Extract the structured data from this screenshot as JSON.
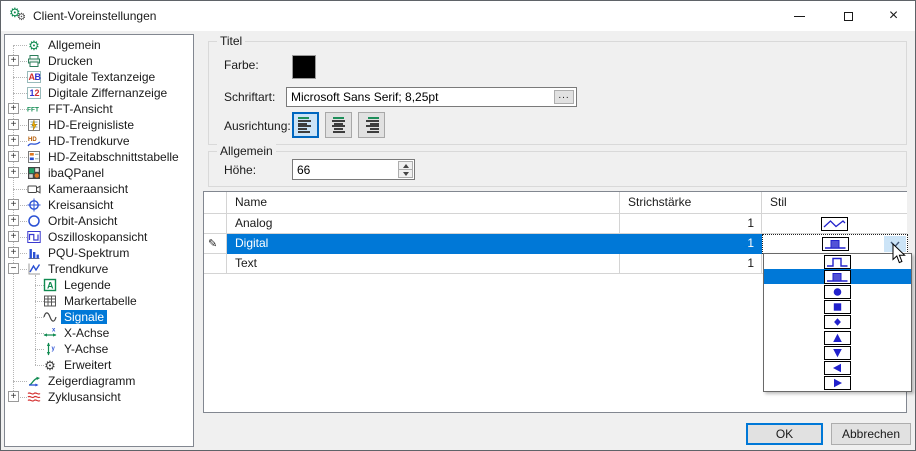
{
  "window": {
    "title": "Client-Voreinstellungen",
    "close_glyph": "×"
  },
  "tree": [
    {
      "label": "Allgemein",
      "icon": "gear-green-icon",
      "level": 0,
      "expander": null
    },
    {
      "label": "Drucken",
      "icon": "printer-icon",
      "level": 0,
      "expander": "plus"
    },
    {
      "label": "Digitale Textanzeige",
      "icon": "text-display-icon",
      "level": 0,
      "expander": null
    },
    {
      "label": "Digitale Ziffernanzeige",
      "icon": "digit-display-icon",
      "level": 0,
      "expander": null
    },
    {
      "label": "FFT-Ansicht",
      "icon": "fft-icon",
      "level": 0,
      "expander": "plus"
    },
    {
      "label": "HD-Ereignisliste",
      "icon": "hd-eventlist-icon",
      "level": 0,
      "expander": "plus"
    },
    {
      "label": "HD-Trendkurve",
      "icon": "hd-trend-icon",
      "level": 0,
      "expander": "plus"
    },
    {
      "label": "HD-Zeitabschnittstabelle",
      "icon": "hd-table-icon",
      "level": 0,
      "expander": "plus"
    },
    {
      "label": "ibaQPanel",
      "icon": "qpanel-icon",
      "level": 0,
      "expander": "plus"
    },
    {
      "label": "Kameraansicht",
      "icon": "camera-icon",
      "level": 0,
      "expander": null
    },
    {
      "label": "Kreisansicht",
      "icon": "kreis-icon",
      "level": 0,
      "expander": "plus"
    },
    {
      "label": "Orbit-Ansicht",
      "icon": "orbit-icon",
      "level": 0,
      "expander": "plus"
    },
    {
      "label": "Oszilloskopansicht",
      "icon": "oszilloskop-icon",
      "level": 0,
      "expander": "plus"
    },
    {
      "label": "PQU-Spektrum",
      "icon": "spektrum-icon",
      "level": 0,
      "expander": "plus"
    },
    {
      "label": "Trendkurve",
      "icon": "trendkurve-icon",
      "level": 0,
      "expander": "minus"
    },
    {
      "label": "Legende",
      "icon": "legende-icon",
      "level": 1,
      "expander": null
    },
    {
      "label": "Markertabelle",
      "icon": "markertabelle-icon",
      "level": 1,
      "expander": null
    },
    {
      "label": "Signale",
      "icon": "signale-icon",
      "level": 1,
      "expander": null,
      "selected": true
    },
    {
      "label": "X-Achse",
      "icon": "x-achse-icon",
      "level": 1,
      "expander": null
    },
    {
      "label": "Y-Achse",
      "icon": "y-achse-icon",
      "level": 1,
      "expander": null
    },
    {
      "label": "Erweitert",
      "icon": "gear-dark-icon",
      "level": 1,
      "expander": null
    },
    {
      "label": "Zeigerdiagramm",
      "icon": "zeiger-icon",
      "level": 0,
      "expander": null
    },
    {
      "label": "Zyklusansicht",
      "icon": "zyklus-icon",
      "level": 0,
      "expander": "plus"
    }
  ],
  "titel_group": {
    "label": "Titel",
    "farbe_label": "Farbe:",
    "farbe_value": "#000000",
    "schriftart_label": "Schriftart:",
    "schriftart_value": "Microsoft Sans Serif; 8,25pt",
    "browse_label": "...",
    "ausrichtung_label": "Ausrichtung:",
    "alignment_options": [
      "left",
      "center",
      "right"
    ],
    "alignment_selected": "left"
  },
  "allgemein_group": {
    "label": "Allgemein",
    "hoehe_label": "Höhe:",
    "hoehe_value": "66"
  },
  "signals_table": {
    "columns": [
      "Name",
      "Strichstärke",
      "Stil"
    ],
    "rows": [
      {
        "name": "Analog",
        "strichstaerke": "1",
        "stil": "zigzag-line",
        "selected": false,
        "editing": false
      },
      {
        "name": "Digital",
        "strichstaerke": "1",
        "stil": "step-filled",
        "selected": true,
        "editing": true
      },
      {
        "name": "Text",
        "strichstaerke": "1",
        "stil": null,
        "selected": false,
        "editing": false
      }
    ]
  },
  "stil_dropdown": {
    "items": [
      "step-outline",
      "step-filled",
      "circle",
      "square",
      "diamond",
      "triangle-up",
      "triangle-down",
      "triangle-left",
      "triangle-right"
    ],
    "selected_index": 1
  },
  "footer": {
    "ok": "OK",
    "cancel": "Abbrechen"
  },
  "colors": {
    "selection": "#0078d7",
    "marker_blue": "#2222cc",
    "combo_button": "#cce4f7",
    "titlebar": "#ffffff",
    "dialog_bg": "#f0f0f0"
  }
}
